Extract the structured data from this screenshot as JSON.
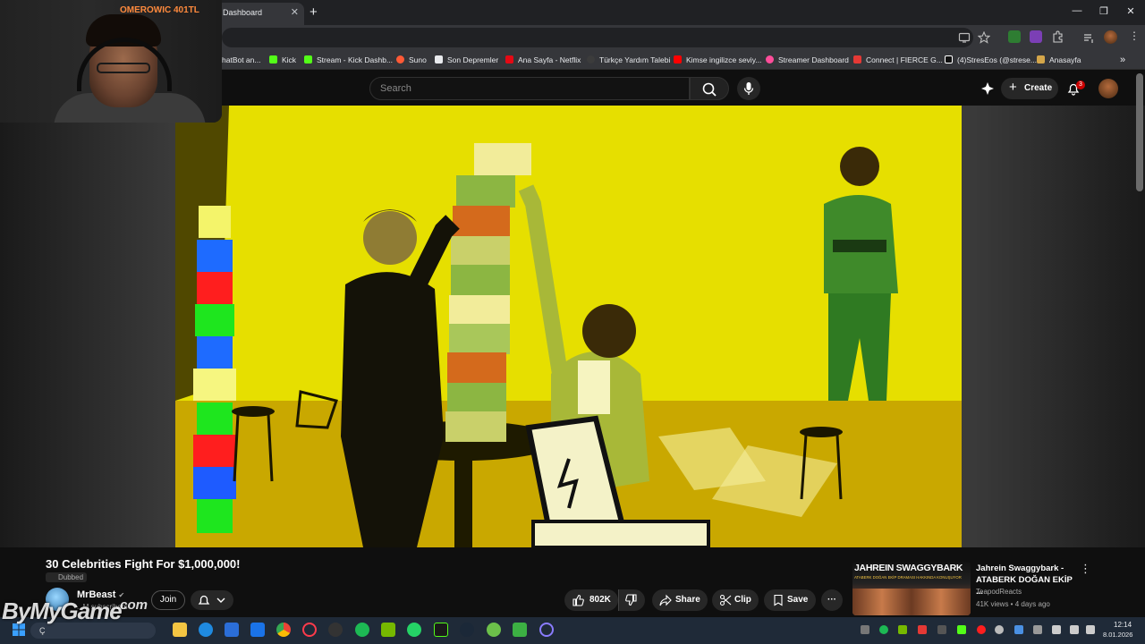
{
  "overlay": {
    "donation": "OMEROWIC 401TL",
    "watermark": "ByMyGame",
    "watermark_suffix": ".com"
  },
  "browser": {
    "tab_title": "k Dashboard",
    "tab_close": "✕",
    "new_tab": "+",
    "window_controls": [
      "—",
      "❐",
      "✕"
    ]
  },
  "bookmarks": [
    {
      "label": "hatBot an...",
      "color": "#8ab4f8"
    },
    {
      "label": "Kick",
      "color": "#53fc18"
    },
    {
      "label": "Stream - Kick Dashb...",
      "color": "#53fc18"
    },
    {
      "label": "Suno",
      "color": "#ff5a36"
    },
    {
      "label": "Son Depremler",
      "color": "#e8eaed"
    },
    {
      "label": "Ana Sayfa - Netflix",
      "color": "#e50914"
    },
    {
      "label": "Türkçe Yardım Talebi",
      "color": "#3c3c3c"
    },
    {
      "label": "Kimse ingilizce seviy...",
      "color": "#ff0000"
    },
    {
      "label": "Streamer Dashboard",
      "color": "#ff4d9a"
    },
    {
      "label": "Connect | FIERCE G...",
      "color": "#e53935"
    },
    {
      "label": "(4)StresEos (@strese...",
      "color": "#ffffff"
    },
    {
      "label": "Anasayfa",
      "color": "#d4a64a"
    }
  ],
  "bookmarks_more": "»",
  "youtube": {
    "search_placeholder": "Search",
    "create_label": "Create",
    "notification_count": "3"
  },
  "video": {
    "title": "30 Celebrities Fight For $1,000,000!",
    "dubbed": "Dubbed",
    "channel_name": "MrBeast",
    "verified": "✔",
    "subscribers": "...M subscribers",
    "join_label": "Join",
    "like_count": "802K",
    "share_label": "Share",
    "clip_label": "Clip",
    "save_label": "Save",
    "more_label": "···"
  },
  "recommendation": {
    "thumb_title": "JAHREIN  SWAGGYBARK",
    "thumb_subtitle": "ATABERK DOĞAN EKİP DRAMASI HAKKINDA KONUŞUYOR",
    "title": "Jahrein Swaggybark - ATABERK DOĞAN EKİP ...",
    "channel": "TeapodReacts",
    "meta": "41K views • 4 days ago",
    "more": "⋮"
  },
  "taskbar": {
    "search_text": "Ç",
    "time": "12:14",
    "date": "8.01.2026"
  },
  "colors": {
    "video_yellow": "#e8e000",
    "youtube_red": "#cc0000",
    "donation_orange": "#ff8a3d"
  }
}
